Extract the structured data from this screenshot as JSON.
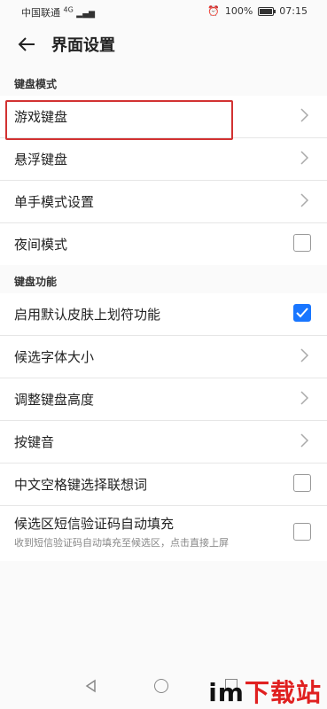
{
  "status": {
    "carrier": "中国联通",
    "network": "4G",
    "battery_text": "100%",
    "battery_level": 1.0,
    "time": "07:15"
  },
  "header": {
    "title": "界面设置"
  },
  "sections": [
    {
      "title": "键盘模式",
      "items": [
        {
          "label": "游戏键盘",
          "control": "chevron"
        },
        {
          "label": "悬浮键盘",
          "control": "chevron"
        },
        {
          "label": "单手模式设置",
          "control": "chevron"
        },
        {
          "label": "夜间模式",
          "control": "checkbox",
          "checked": false
        }
      ]
    },
    {
      "title": "键盘功能",
      "items": [
        {
          "label": "启用默认皮肤上划符功能",
          "control": "checkbox",
          "checked": true
        },
        {
          "label": "候选字体大小",
          "control": "chevron"
        },
        {
          "label": "调整键盘高度",
          "control": "chevron"
        },
        {
          "label": "按键音",
          "control": "chevron"
        },
        {
          "label": "中文空格键选择联想词",
          "control": "checkbox",
          "checked": false
        },
        {
          "label": "候选区短信验证码自动填充",
          "subtitle": "收到短信验证码自动填充至候选区，点击直接上屏",
          "control": "checkbox",
          "checked": false
        }
      ]
    }
  ],
  "watermark": {
    "left": "im",
    "right": "下载站"
  },
  "colors": {
    "accent": "#1976ff",
    "highlight": "#d23232"
  }
}
